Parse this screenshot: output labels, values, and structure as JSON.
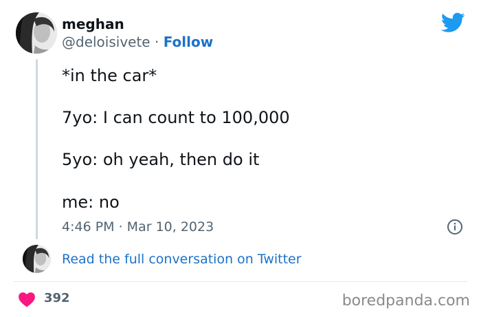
{
  "author": {
    "display_name": "meghan",
    "handle": "@deloisivete",
    "separator": " · ",
    "follow_label": "Follow"
  },
  "tweet": {
    "lines": [
      "*in the car*",
      "7yo: I can count to 100,000",
      "5yo: oh yeah, then do it",
      "me: no"
    ],
    "timestamp": "4:46 PM · Mar 10, 2023"
  },
  "conversation_link": "Read the full conversation on Twitter",
  "engagement": {
    "likes": "392"
  },
  "watermark": "boredpanda.com",
  "colors": {
    "twitter_blue": "#1d9bf0",
    "link_blue": "#1d72c7",
    "heart_pink": "#f91880",
    "muted_text": "#536471"
  },
  "icons": {
    "brand": "twitter-bird-icon",
    "info": "info-icon",
    "like": "heart-icon"
  }
}
